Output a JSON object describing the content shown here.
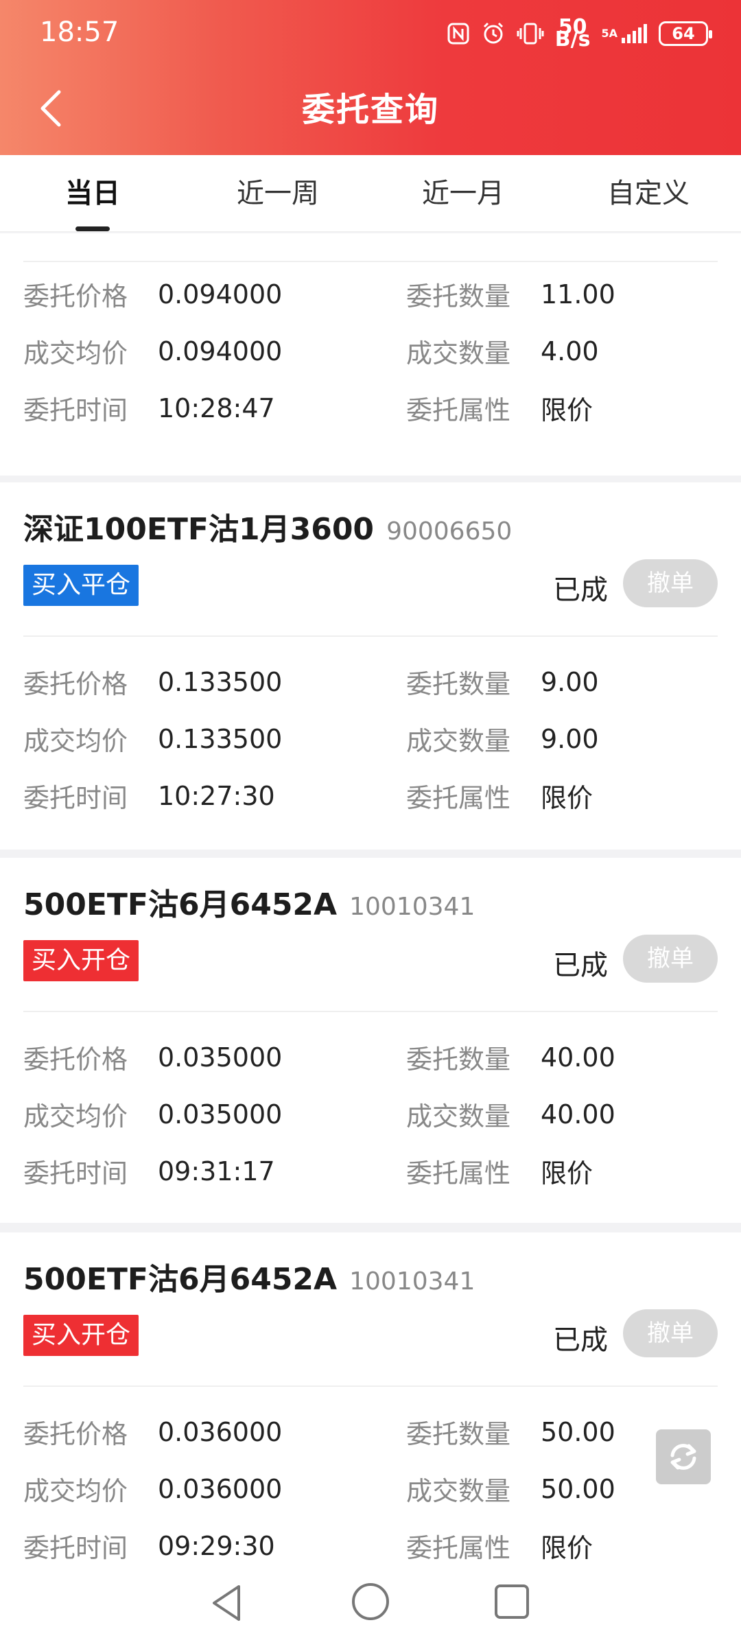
{
  "status_bar": {
    "time": "18:57",
    "net_speed_top": "50",
    "net_speed_bottom": "B/s",
    "signal_label": "5A",
    "battery": "64"
  },
  "nav": {
    "title": "委托查询"
  },
  "tabs": [
    "当日",
    "近一周",
    "近一月",
    "自定义"
  ],
  "labels": {
    "price": "委托价格",
    "avg": "成交均价",
    "time": "委托时间",
    "qty": "委托数量",
    "filled": "成交数量",
    "attr": "委托属性",
    "cancel": "撤单"
  },
  "orders": [
    {
      "price": "0.094000",
      "avg": "0.094000",
      "time": "10:28:47",
      "qty": "11.00",
      "filled": "4.00",
      "attr": "限价"
    },
    {
      "name": "深证100ETF沽1月3600",
      "code": "90006650",
      "tag": "买入平仓",
      "status": "已成",
      "price": "0.133500",
      "avg": "0.133500",
      "time": "10:27:30",
      "qty": "9.00",
      "filled": "9.00",
      "attr": "限价"
    },
    {
      "name": "500ETF沽6月6452A",
      "code": "10010341",
      "tag": "买入开仓",
      "status": "已成",
      "price": "0.035000",
      "avg": "0.035000",
      "time": "09:31:17",
      "qty": "40.00",
      "filled": "40.00",
      "attr": "限价"
    },
    {
      "name": "500ETF沽6月6452A",
      "code": "10010341",
      "tag": "买入开仓",
      "status": "已成",
      "price": "0.036000",
      "avg": "0.036000",
      "time": "09:29:30",
      "qty": "50.00",
      "filled": "50.00",
      "attr": "限价"
    }
  ]
}
